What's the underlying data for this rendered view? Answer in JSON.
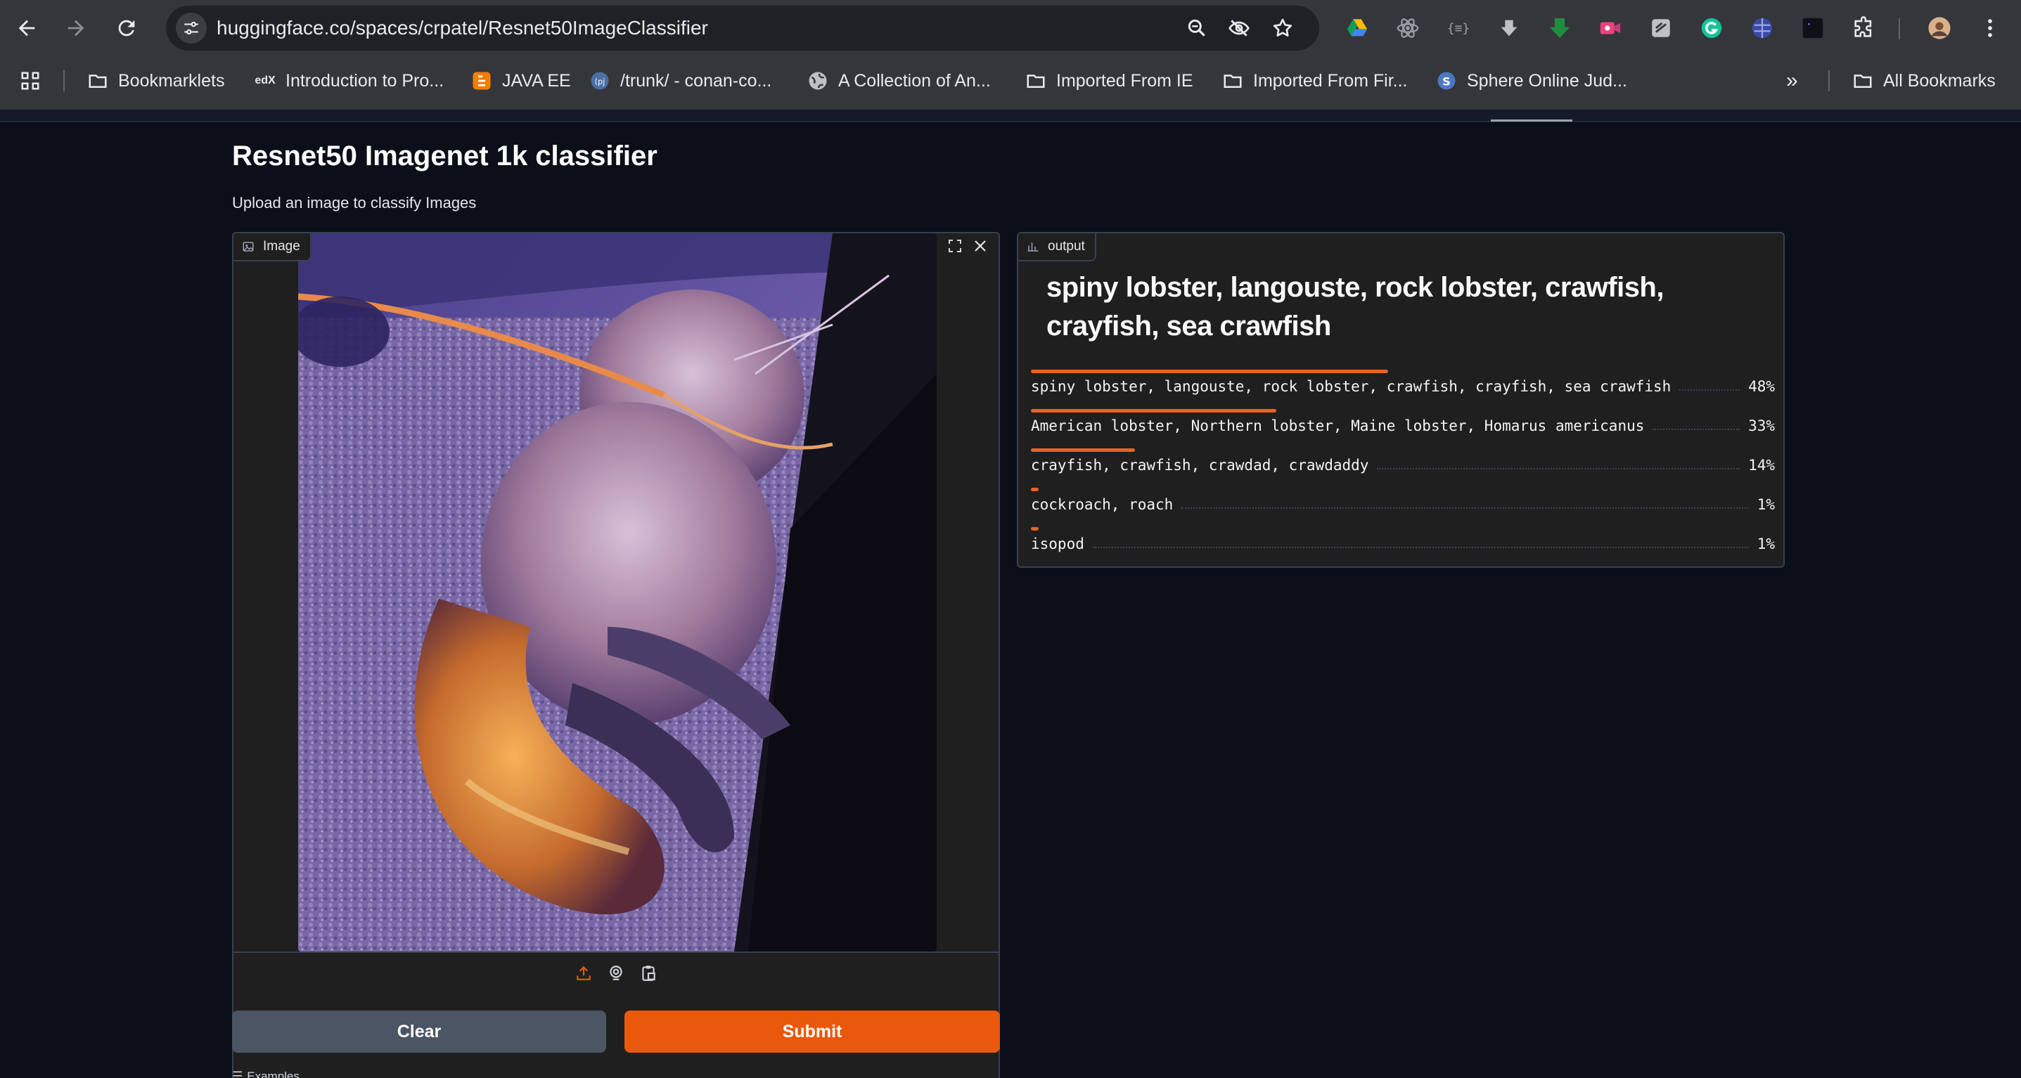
{
  "browser": {
    "url_host": "huggingface.co",
    "url_path": "/spaces/crpatel/Resnet50ImageClassifier"
  },
  "bookmarks": [
    {
      "label": "Bookmarklets",
      "icon": "folder-icon"
    },
    {
      "label": "Introduction to Pro...",
      "icon": "edx-icon"
    },
    {
      "label": "JAVA EE",
      "icon": "blogger-icon"
    },
    {
      "label": "/trunk/ - conan-co...",
      "icon": "trac-icon"
    },
    {
      "label": "A Collection of An...",
      "icon": "globe-icon"
    },
    {
      "label": "Imported From IE",
      "icon": "folder-icon"
    },
    {
      "label": "Imported From Fir...",
      "icon": "folder-icon"
    },
    {
      "label": "Sphere Online Jud...",
      "icon": "spoj-icon"
    }
  ],
  "bookmarks_overflow": "»",
  "all_bookmarks": "All Bookmarks",
  "app": {
    "title": "Resnet50 Imagenet 1k classifier",
    "description": "Upload an image to classify Images",
    "image_label": "Image",
    "output_label": "output",
    "top_prediction": "spiny lobster, langouste, rock lobster, crawfish, crayfish, sea crawfish",
    "confidences": [
      {
        "label": "spiny lobster, langouste, rock lobster, crawfish, crayfish, sea crawfish",
        "pct": "48%",
        "value": 0.48
      },
      {
        "label": "American lobster, Northern lobster, Maine lobster, Homarus americanus",
        "pct": "33%",
        "value": 0.33
      },
      {
        "label": "crayfish, crawfish, crawdad, crawdaddy",
        "pct": "14%",
        "value": 0.14
      },
      {
        "label": "cockroach, roach",
        "pct": "1%",
        "value": 0.01
      },
      {
        "label": "isopod",
        "pct": "1%",
        "value": 0.01
      }
    ],
    "clear_label": "Clear",
    "submit_label": "Submit",
    "examples_label": "Examples"
  },
  "colors": {
    "accent": "#ea580c",
    "bar": "#e66325",
    "background": "#0b0f19",
    "panel": "#1f1f1f"
  }
}
